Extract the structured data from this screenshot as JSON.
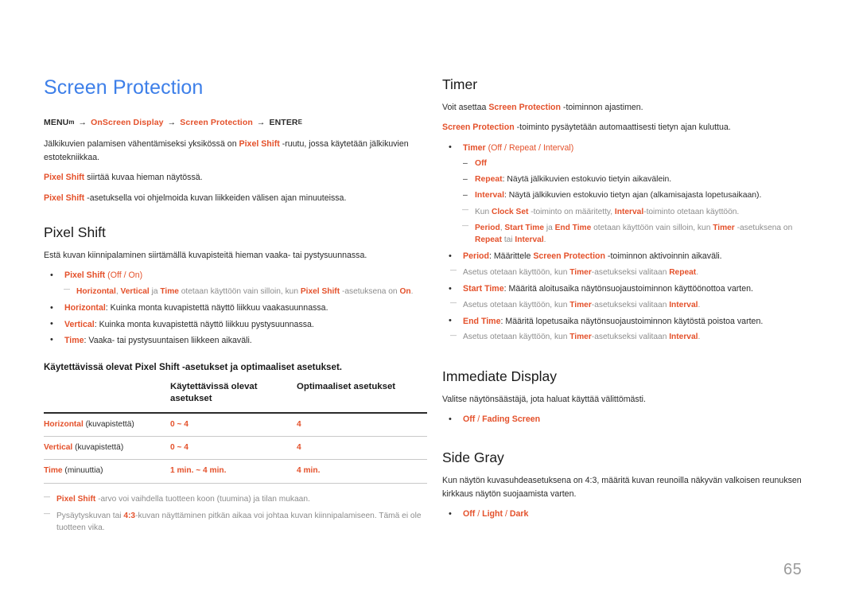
{
  "page": {
    "title": "Screen Protection",
    "number": "65",
    "accent_blue": "#3d7fe9",
    "accent_orange": "#e4512b",
    "muted_gray": "#8c8c8c"
  },
  "breadcrumb": {
    "start": "MENU",
    "start_key": "m",
    "step1": "OnScreen Display",
    "step2": "Screen Protection",
    "end": "ENTER",
    "end_key": "E",
    "arrow": "→"
  },
  "intro": {
    "p1_a": "Jälkikuvien palamisen vähentämiseksi yksikössä on ",
    "p1_hl": "Pixel Shift",
    "p1_b": " -ruutu, jossa käytetään jälkikuvien estotekniikkaa.",
    "p2_hl": "Pixel Shift",
    "p2_b": " siirtää kuvaa hieman näytössä.",
    "p3_hl": "Pixel Shift",
    "p3_b": " -asetuksella voi ohjelmoida kuvan liikkeiden välisen ajan minuuteissa."
  },
  "pixel_shift": {
    "heading": "Pixel Shift",
    "desc": "Estä kuvan kiinnipalaminen siirtämällä kuvapisteitä hieman vaaka- tai pystysuunnassa.",
    "b1_hl": "Pixel Shift",
    "b1_rest_open": " (",
    "b1_opt1": "Off",
    "b1_sep": " / ",
    "b1_opt2": "On",
    "b1_rest_close": ")",
    "note1_hl1": "Horizontal",
    "note1_t1": ", ",
    "note1_hl2": "Vertical",
    "note1_t2": " ja ",
    "note1_hl3": "Time",
    "note1_t3": " otetaan käyttöön vain silloin, kun ",
    "note1_hl4": "Pixel Shift",
    "note1_t4": " -asetuksena on ",
    "note1_hl5": "On",
    "note1_t5": ".",
    "b2_hl": "Horizontal",
    "b2_text": ": Kuinka monta kuvapistettä näyttö liikkuu vaakasuunnassa.",
    "b3_hl": "Vertical",
    "b3_text": ": Kuinka monta kuvapistettä näyttö liikkuu pystysuunnassa.",
    "b4_hl": "Time",
    "b4_text": ": Vaaka- tai pystysuuntaisen liikkeen aikaväli."
  },
  "table": {
    "intro_a": "Käytettävissä olevat Pixel Shift -asetukset ja optimaaliset asetukset.",
    "headers": [
      "",
      "Käytettävissä olevat asetukset",
      "Optimaaliset asetukset"
    ],
    "rows": [
      {
        "label_hl": "Horizontal",
        "label_rest": " (kuvapistettä)",
        "available": "0 ~ 4",
        "optimal": "4"
      },
      {
        "label_hl": "Vertical",
        "label_rest": " (kuvapistettä)",
        "available": "0 ~ 4",
        "optimal": "4"
      },
      {
        "label_hl": "Time",
        "label_rest": " (minuuttia)",
        "available": "1 min. ~ 4 min.",
        "optimal": "4 min."
      }
    ],
    "footnotes": [
      {
        "hl": "Pixel Shift",
        "text": " -arvo voi vaihdella tuotteen koon (tuumina) ja tilan mukaan."
      },
      {
        "pre": "Pysäytyskuvan tai ",
        "hl": "4:3",
        "text": "-kuvan näyttäminen pitkän aikaa voi johtaa kuvan kiinnipalamiseen. Tämä ei ole tuotteen vika."
      }
    ]
  },
  "timer": {
    "heading": "Timer",
    "p1_a": "Voit asettaa ",
    "p1_hl": "Screen Protection",
    "p1_b": " -toiminnon ajastimen.",
    "p2_hl": "Screen Protection",
    "p2_b": " -toiminto pysäytetään automaattisesti tietyn ajan kuluttua.",
    "b1_hl": "Timer",
    "b1_open": " (",
    "b1_opt1": "Off",
    "b1_sep1": " / ",
    "b1_opt2": "Repeat",
    "b1_sep2": " / ",
    "b1_opt3": "Interval",
    "b1_close": ")",
    "d1_hl": "Off",
    "d2_hl": "Repeat",
    "d2_text": ": Näytä jälkikuvien estokuvio tietyin aikavälein.",
    "d3_hl": "Interval",
    "d3_text": ": Näytä jälkikuvien estokuvio tietyn ajan (alkamisajasta lopetusaikaan).",
    "n1_a": "Kun ",
    "n1_hl1": "Clock Set",
    "n1_b": " -toiminto on määritetty, ",
    "n1_hl2": "Interval",
    "n1_c": "-toiminto otetaan käyttöön.",
    "n2_hl1": "Period",
    "n2_a": ", ",
    "n2_hl2": "Start Time",
    "n2_b": " ja ",
    "n2_hl3": "End Time",
    "n2_c": " otetaan käyttöön vain silloin, kun ",
    "n2_hl4": "Timer",
    "n2_d": " -asetuksena on ",
    "n2_hl5": "Repeat",
    "n2_e": " tai ",
    "n2_hl6": "Interval",
    "n2_f": ".",
    "b2_hl": "Period",
    "b2_a": ": Määrittele ",
    "b2_hl2": "Screen Protection",
    "b2_b": " -toiminnon aktivoinnin aikaväli.",
    "n3_a": "Asetus otetaan käyttöön, kun ",
    "n3_hl1": "Timer",
    "n3_b": "-asetukseksi valitaan ",
    "n3_hl2": "Repeat",
    "n3_c": ".",
    "b3_hl": "Start Time",
    "b3_text": ": Määritä aloitusaika näytönsuojaustoiminnon käyttöönottoa varten.",
    "n4_a": "Asetus otetaan käyttöön, kun ",
    "n4_hl1": "Timer",
    "n4_b": "-asetukseksi valitaan ",
    "n4_hl2": "Interval",
    "n4_c": ".",
    "b4_hl": "End Time",
    "b4_text": ": Määritä lopetusaika näytönsuojaustoiminnon käytöstä poistoa varten.",
    "n5_a": "Asetus otetaan käyttöön, kun ",
    "n5_hl1": "Timer",
    "n5_b": "-asetukseksi valitaan ",
    "n5_hl2": "Interval",
    "n5_c": "."
  },
  "immediate_display": {
    "heading": "Immediate Display",
    "desc": "Valitse näytönsäästäjä, jota haluat käyttää välittömästi.",
    "opt1": "Off",
    "sep1": " / ",
    "opt2": "Fading Screen"
  },
  "side_gray": {
    "heading": "Side Gray",
    "desc": "Kun näytön kuvasuhdeasetuksena on 4:3, määritä kuvan reunoilla näkyvän valkoisen reunuksen kirkkaus näytön suojaamista varten.",
    "opt1": "Off",
    "sep1": " / ",
    "opt2": "Light",
    "sep2": " / ",
    "opt3": "Dark"
  }
}
